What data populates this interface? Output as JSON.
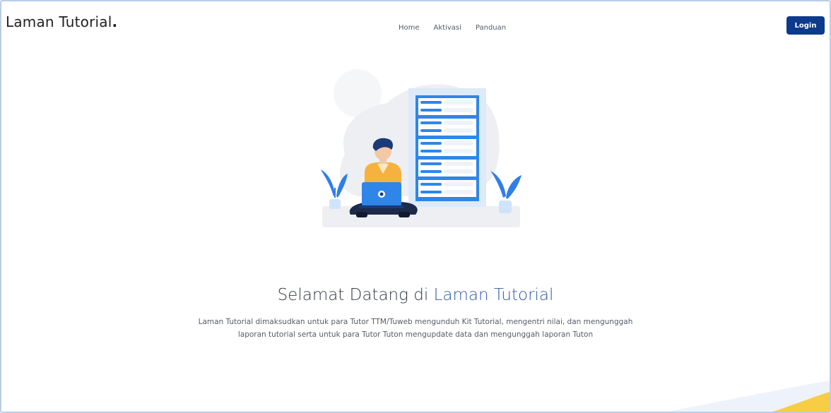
{
  "brand": {
    "name": "Laman Tutorial",
    "dot": "."
  },
  "nav": {
    "items": [
      {
        "label": "Home"
      },
      {
        "label": "Aktivasi"
      },
      {
        "label": "Panduan"
      }
    ],
    "login_label": "Login"
  },
  "hero": {
    "title_prefix": "Selamat Datang di ",
    "title_accent": "Laman Tutorial",
    "description": "Laman Tutorial dimaksudkan untuk para Tutor TTM/Tuweb mengunduh Kit Tutorial, mengentri nilai, dan mengunggah laporan tutorial serta untuk para Tutor Tuton mengupdate data dan mengunggah laporan Tuton"
  },
  "colors": {
    "primary": "#0d3a8a",
    "accent_text": "#2d5aa6",
    "server_blue": "#2f86e8",
    "plant": "#2f7fe6",
    "shirt": "#f6b23e",
    "corner_yellow": "#f7cd45",
    "frame_border": "#b9cdea"
  },
  "illustration": {
    "icon": "person-laptop-server-illustration"
  }
}
